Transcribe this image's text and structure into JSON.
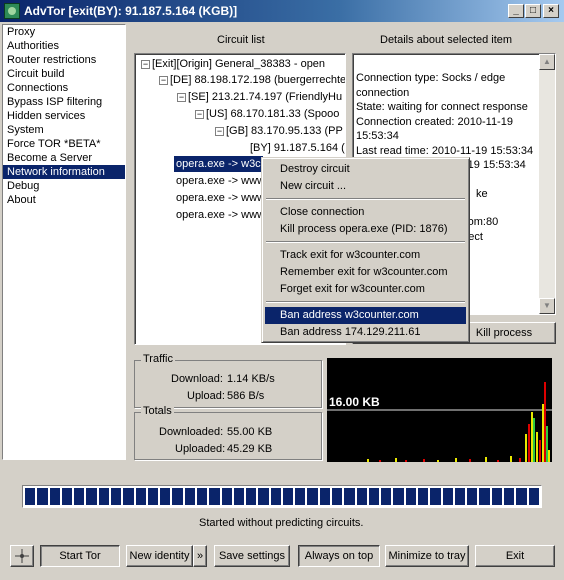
{
  "window": {
    "title": "AdvTor [exit(BY): 91.187.5.164 (KGB)]"
  },
  "sidebar": {
    "items": [
      "Proxy",
      "Authorities",
      "Router restrictions",
      "Circuit build",
      "Connections",
      "Bypass ISP filtering",
      "Hidden services",
      "System",
      "Force TOR *BETA*",
      "Become a Server",
      "Network information",
      "Debug",
      "About"
    ],
    "selected": "Network information"
  },
  "circuits": {
    "header": "Circuit list",
    "rows": [
      "[Exit][Origin] General_38383 - open",
      "[DE] 88.198.172.198 (buergerrechte",
      "[SE] 213.21.74.197 (FriendlyHu",
      "[US] 68.170.181.33 (Spooo",
      "[GB] 83.170.95.133 (PP",
      "[BY] 91.187.5.164 (",
      "opera.exe -> w3c",
      "opera.exe -> www",
      "opera.exe -> www",
      "opera.exe -> www"
    ]
  },
  "details": {
    "header": "Details about selected item",
    "lines": [
      "Connection type: Socks / edge connection",
      "State: waiting for connect response",
      "Connection created: 2010-11-19 15:53:34",
      "Last read time: 2010-11-19 15:53:34",
      "-19 15:53:34",
      "ke",
      "r.com:80",
      "nnect"
    ]
  },
  "menu": {
    "items": [
      "Destroy circuit",
      "New circuit ...",
      "Close connection",
      "Kill process opera.exe (PID: 1876)",
      "Track exit for w3counter.com",
      "Remember exit for w3counter.com",
      "Forget exit for w3counter.com",
      "Ban address w3counter.com",
      "Ban address 174.129.211.61"
    ],
    "highlighted": "Ban address w3counter.com"
  },
  "buttons": {
    "kill_process": "Kill process",
    "start_tor": "Start Tor",
    "new_identity": "New identity",
    "more": "»",
    "save_settings": "Save settings",
    "always_on_top": "Always on top",
    "minimize": "Minimize to tray",
    "exit": "Exit"
  },
  "traffic": {
    "title": "Traffic",
    "download_label": "Download:",
    "download_value": "1.14 KB/s",
    "upload_label": "Upload:",
    "upload_value": "586 B/s"
  },
  "totals": {
    "title": "Totals",
    "downloaded_label": "Downloaded:",
    "downloaded_value": "55.00 KB",
    "uploaded_label": "Uploaded:",
    "uploaded_value": "45.29 KB"
  },
  "graph": {
    "scale_label": "16.00 KB"
  },
  "status": {
    "text": "Started without predicting circuits.",
    "progress": 1.0
  },
  "colors": {
    "selection": "#0a246a",
    "title_gradient_start": "#0a246a"
  }
}
